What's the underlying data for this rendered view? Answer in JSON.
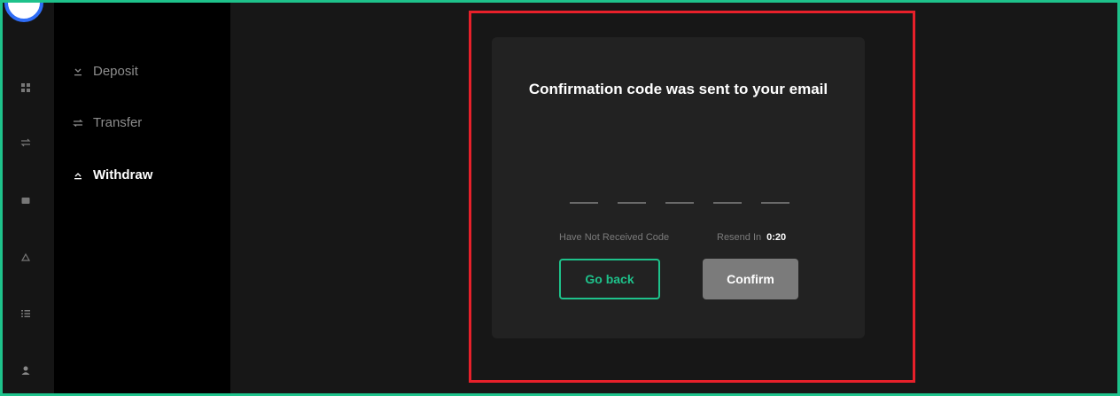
{
  "sidebar": {
    "rail_icons": [
      "dashboard-icon",
      "swap-icon",
      "wallet-icon",
      "recycle-icon",
      "list-icon",
      "user-icon"
    ],
    "submenu": [
      {
        "label": "Deposit",
        "icon": "arrow-down-icon",
        "active": false
      },
      {
        "label": "Transfer",
        "icon": "transfer-icon",
        "active": false
      },
      {
        "label": "Withdraw",
        "icon": "arrow-up-icon",
        "active": true
      }
    ]
  },
  "dialog": {
    "title": "Confirmation code was sent to your email",
    "code_slots": 5,
    "not_received_label": "Have Not Received Code",
    "resend_label": "Resend In",
    "resend_timer": "0:20",
    "back_button": "Go back",
    "confirm_button": "Confirm"
  },
  "colors": {
    "accent": "#1ec28b",
    "highlight": "#e8202a",
    "card_bg": "#222222",
    "disabled_button": "#7b7b7b"
  }
}
